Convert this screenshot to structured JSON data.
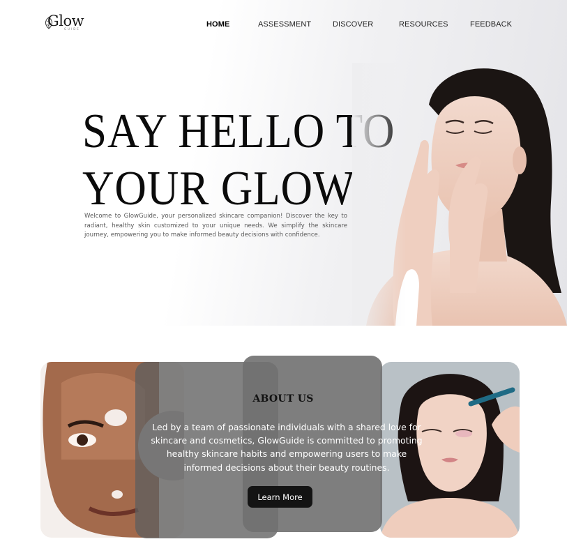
{
  "brand": {
    "logo_text": "Glow",
    "logo_sub": "GUIDE"
  },
  "nav": {
    "items": [
      {
        "label": "HOME",
        "active": true
      },
      {
        "label": "ASSESSMENT",
        "active": false
      },
      {
        "label": "DISCOVER",
        "active": false
      },
      {
        "label": "RESOURCES",
        "active": false
      },
      {
        "label": "FEEDBACK",
        "active": false
      }
    ]
  },
  "hero": {
    "title_line1": "SAY HELLO TO",
    "title_line2": "YOUR GLOW",
    "description": "Welcome to GlowGuide, your personalized skincare companion! Discover the key to radiant, healthy skin customized to your unique needs. We simplify the skincare journey, empowering you to make informed beauty decisions with confidence."
  },
  "about": {
    "title": "ABOUT US",
    "text": "Led by a team of passionate individuals with a shared love for skincare and cosmetics, GlowGuide is committed to promoting healthy skincare habits and empowering users to make informed decisions about their beauty routines.",
    "button_label": "Learn More"
  },
  "colors": {
    "text_dark": "#0b0b0b",
    "button_bg": "#141414",
    "overlay_gray": "#6a6a6a"
  },
  "icons": {
    "logo": "leaf-logo-icon"
  }
}
